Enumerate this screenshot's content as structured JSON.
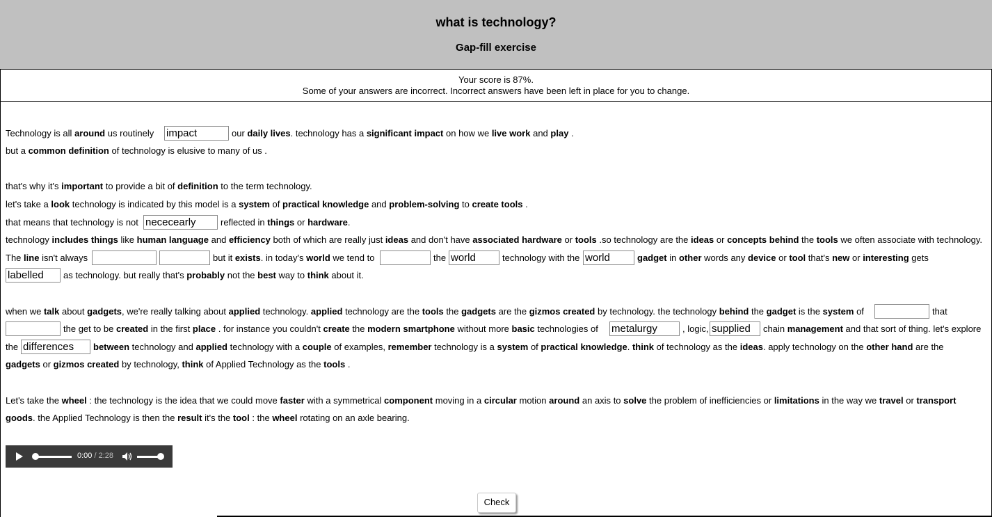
{
  "header": {
    "title": "what is technology?",
    "subtitle": "Gap-fill exercise"
  },
  "feedback": {
    "score": "Your score is 87%.",
    "message": "Some of your answers are incorrect. Incorrect answers have been left in place for you to change."
  },
  "text": {
    "p1_1": "Technology is all around us routinely",
    "p1_2": "our daily lives. technology has a significant impact on how we live work and play .",
    "p1_3": "but a common definition of technology is elusive to many of us .",
    "p2_1": "that's why it's important to provide a bit of definition to the term technology.",
    "p2_2": "let's take a look technology is indicated by this model is a system of practical knowledge and problem-solving to create tools .",
    "p2_3a": "that means that technology is not",
    "p2_3b": "reflected in things or hardware.",
    "p2_4": "technology includes things like human language and efficiency both of which are really just ideas and don't have associated hardware or tools .so technology are the ideas or concepts behind the tools we often associate with technology.",
    "p2_5a": "The line isn't always",
    "p2_5b": "but it exists. in today's world we tend to",
    "p2_5c": "the",
    "p2_5d": "technology with the",
    "p2_5e": "gadget in other words any device or tool that's new or interesting gets",
    "p2_6": "as technology. but really that's probably not the best way to think about it.",
    "p3_1a": "when we talk about gadgets, we're really talking about applied technology. applied technology are the tools the gadgets are the gizmos created by technology. the technology behind the gadget is the system of",
    "p3_1b": "that",
    "p3_2a": "the get to be created in the first place . for instance you couldn't create the modern smartphone without more basic technologies of",
    "p3_2b": ", logic,",
    "p3_2c": "chain management and that sort of thing. let's explore",
    "p3_3a": "the",
    "p3_3b": "between technology and applied technology with a couple of examples, remember technology is a system of practical knowledge. think of technology as the ideas. apply technology on the other hand are the",
    "p3_4": "gadgets or gizmos created by technology, think of Applied Technology as the tools .",
    "p4_1": "Let's take the wheel : the technology is the idea that we could move faster with a symmetrical component moving in a circular motion around an axis to solve the problem of inefficiencies or limitations in the way we travel or transport",
    "p4_2": "goods. the Applied Technology is then the result it's the tool : the wheel rotating on an axle bearing."
  },
  "gaps": {
    "g1": "impact",
    "g2": "nececearly",
    "g3": "",
    "g4": "",
    "g5": "",
    "g6": "world",
    "g7": "world",
    "g8": "labelled",
    "g9": "",
    "g10": "",
    "g11": "metalurgy",
    "g12": "supplied",
    "g13": "differences"
  },
  "player": {
    "current_time": "0:00",
    "duration": "/ 2:28",
    "progress": 0,
    "volume": 1
  },
  "check_button": "Check"
}
